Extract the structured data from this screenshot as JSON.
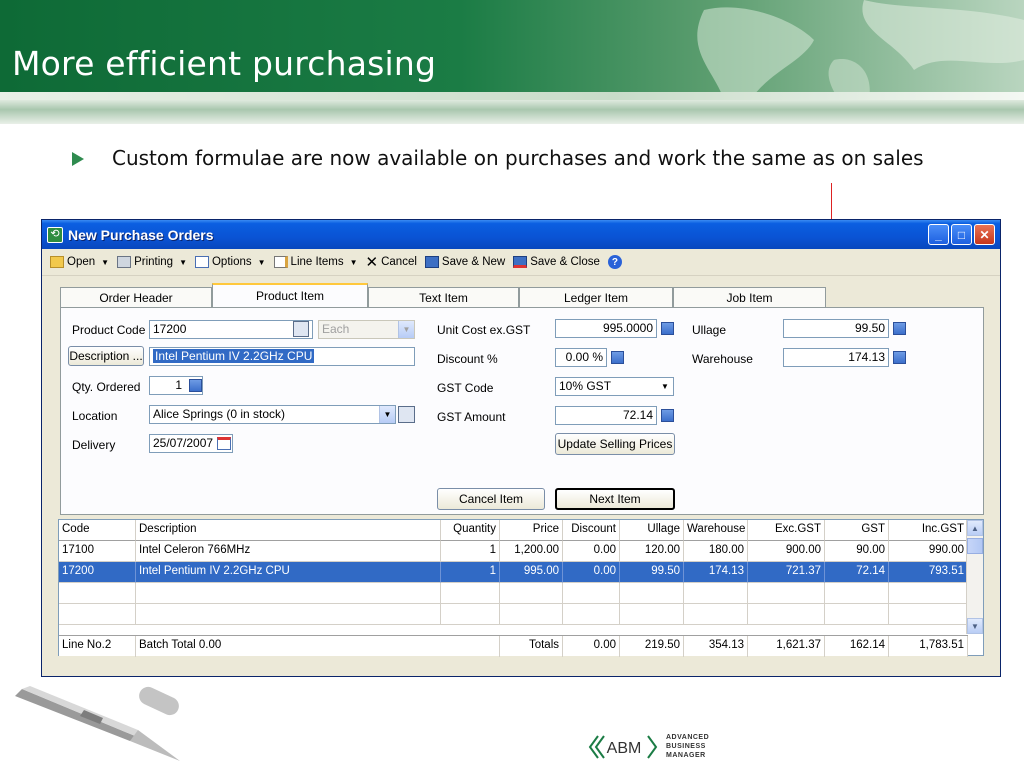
{
  "slide": {
    "title": "More efficient purchasing",
    "bullet": "Custom formulae are now available on purchases and work the same as on sales"
  },
  "window": {
    "title": "New Purchase Orders",
    "controls": {
      "minimize": "_",
      "maximize": "□",
      "close": "✕"
    }
  },
  "toolbar": {
    "items": [
      "Open",
      "Printing",
      "Options",
      "Line Items",
      "Cancel",
      "Save & New",
      "Save & Close"
    ]
  },
  "tabs": [
    "Order Header",
    "Product Item",
    "Text Item",
    "Ledger Item",
    "Job Item"
  ],
  "form": {
    "product_code_label": "Product Code",
    "product_code": "17200",
    "unit": "Each",
    "description_button": "Description ...",
    "description": "Intel Pentium IV 2.2GHz CPU",
    "qty_label": "Qty. Ordered",
    "qty": "1",
    "location_label": "Location",
    "location": "Alice Springs (0 in stock)",
    "delivery_label": "Delivery",
    "delivery": "25/07/2007",
    "unit_cost_label": "Unit Cost ex.GST",
    "unit_cost": "995.0000",
    "discount_label": "Discount %",
    "discount": "0.00 %",
    "gst_code_label": "GST Code",
    "gst_code": "10% GST",
    "gst_amount_label": "GST Amount",
    "gst_amount": "72.14",
    "update_prices_button": "Update Selling Prices",
    "ullage_label": "Ullage",
    "ullage": "99.50",
    "warehouse_label": "Warehouse",
    "warehouse": "174.13",
    "cancel_item_button": "Cancel Item",
    "next_item_button": "Next Item"
  },
  "grid": {
    "columns": [
      "Code",
      "Description",
      "Quantity",
      "Price",
      "Discount",
      "Ullage",
      "Warehouse",
      "Exc.GST",
      "GST",
      "Inc.GST"
    ],
    "rows": [
      [
        "17100",
        "Intel Celeron 766MHz",
        "1",
        "1,200.00",
        "0.00",
        "120.00",
        "180.00",
        "900.00",
        "90.00",
        "990.00"
      ],
      [
        "17200",
        "Intel Pentium IV 2.2GHz CPU",
        "1",
        "995.00",
        "0.00",
        "99.50",
        "174.13",
        "721.37",
        "72.14",
        "793.51"
      ]
    ],
    "footer": {
      "line_no": "Line No.2",
      "batch_total": "Batch Total 0.00",
      "totals_label": "Totals",
      "discount": "0.00",
      "ullage": "219.50",
      "warehouse": "354.13",
      "exc_gst": "1,621.37",
      "gst": "162.14",
      "inc_gst": "1,783.51"
    }
  },
  "logo": {
    "mark": "ABM",
    "lines": [
      "ADVANCED",
      "BUSINESS",
      "MANAGER"
    ]
  },
  "colors": {
    "banner": "#1b7c45",
    "selection": "#316ac5",
    "titlebar": "#0a53d4"
  }
}
